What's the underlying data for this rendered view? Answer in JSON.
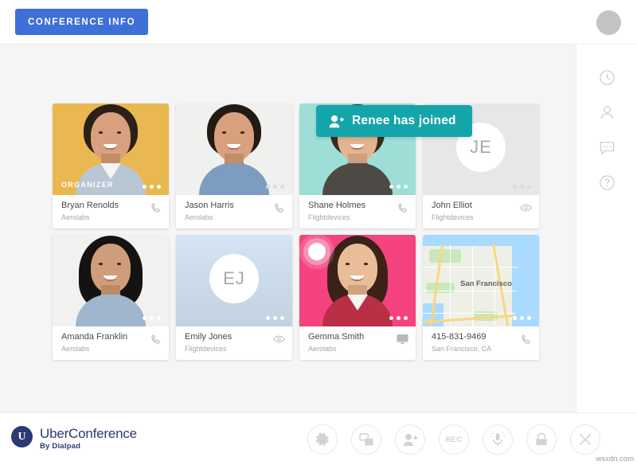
{
  "header": {
    "conference_info_label": "CONFERENCE INFO",
    "avatar_icon": "user-avatar"
  },
  "toast": {
    "text": "Renee has joined",
    "icon": "person-add-icon",
    "color": "#13a5aa"
  },
  "right_rail": [
    {
      "name": "history-icon",
      "glyph": "clock"
    },
    {
      "name": "participants-icon",
      "glyph": "person"
    },
    {
      "name": "chat-icon",
      "glyph": "chat-bubble"
    },
    {
      "name": "help-icon",
      "glyph": "question-circle"
    }
  ],
  "participants": [
    {
      "name": "Bryan Renolds",
      "org": "Aerolabs",
      "badge": "ORGANIZER",
      "media": "photo",
      "bg": "#e9b850",
      "hair": "#2b2018",
      "shirt": "#b9c6d4",
      "status_icon": "phone-icon",
      "speaking": false
    },
    {
      "name": "Jason Harris",
      "org": "Aerolabs",
      "badge": "",
      "media": "photo",
      "bg": "#f0f0ee",
      "hair": "#241a14",
      "shirt": "#7c9cc0",
      "status_icon": "phone-icon",
      "speaking": false
    },
    {
      "name": "Shane Holmes",
      "org": "Flightdevices",
      "badge": "",
      "media": "photo",
      "bg": "#9fded7",
      "hair": "#3a2a1e",
      "shirt": "#4d4a45",
      "status_icon": "phone-icon",
      "speaking": false
    },
    {
      "name": "John Elliot",
      "org": "Flightdevices",
      "badge": "",
      "media": "initials",
      "initials": "JE",
      "bg": "#e6e7e8",
      "status_icon": "eye-icon",
      "speaking": false
    },
    {
      "name": "Amanda Franklin",
      "org": "Aerolabs",
      "badge": "",
      "media": "photo",
      "bg": "#f1f1ef",
      "hair": "#151312",
      "shirt": "#9fb6cd",
      "status_icon": "phone-icon",
      "speaking": false
    },
    {
      "name": "Emily Jones",
      "org": "Flightdevices",
      "badge": "",
      "media": "initials",
      "initials": "EJ",
      "bg": "#cfe0f0",
      "status_icon": "eye-icon",
      "speaking": false
    },
    {
      "name": "Gemma Smith",
      "org": "Aerolabs",
      "badge": "",
      "media": "photo",
      "bg": "#f4437e",
      "hair": "#3b2118",
      "shirt": "#b92f46",
      "status_icon": "screen-share-icon",
      "speaking": true
    },
    {
      "name": "415-831-9469",
      "org": "San Francisco, CA",
      "badge": "",
      "media": "map",
      "map_label": "San Francisco",
      "bg": "#eef0e8",
      "status_icon": "phone-icon",
      "speaking": false
    }
  ],
  "footer": {
    "brand_mark": "U",
    "brand_name": "UberConference",
    "brand_sub": "By Dialpad",
    "tools": [
      {
        "name": "settings-button",
        "icon": "gear-icon",
        "label": ""
      },
      {
        "name": "screen-share-button",
        "icon": "screen-share-icon",
        "label": ""
      },
      {
        "name": "add-participant-button",
        "icon": "person-add-icon",
        "label": ""
      },
      {
        "name": "record-button",
        "icon": "rec-icon",
        "label": "REC"
      },
      {
        "name": "mute-button",
        "icon": "microphone-icon",
        "label": ""
      },
      {
        "name": "lock-call-button",
        "icon": "lock-icon",
        "label": ""
      },
      {
        "name": "end-call-button",
        "icon": "close-icon",
        "label": ""
      }
    ]
  },
  "watermark": "wsxdn.com"
}
